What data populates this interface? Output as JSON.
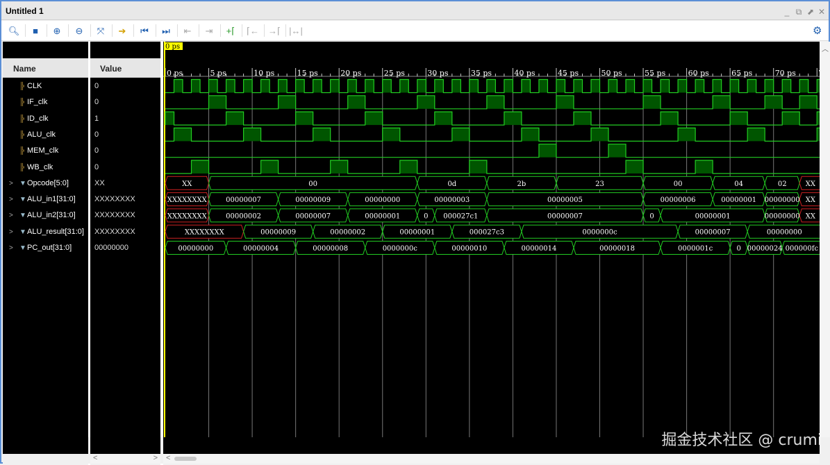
{
  "window": {
    "title": "Untitled 1",
    "controls": [
      "minimize",
      "restore",
      "maximize",
      "close"
    ]
  },
  "toolbar": {
    "buttons": [
      {
        "name": "search-icon",
        "glyph": "🔍︎"
      },
      {
        "name": "save-icon",
        "glyph": "■"
      },
      {
        "name": "zoom-in-icon",
        "glyph": "⊕"
      },
      {
        "name": "zoom-out-icon",
        "glyph": "⊖"
      },
      {
        "name": "zoom-fit-icon",
        "glyph": "⤧"
      },
      {
        "name": "go-to-cursor-icon",
        "glyph": "➔"
      },
      {
        "name": "go-to-time-zero-icon",
        "glyph": "⏮"
      },
      {
        "name": "go-to-last-time-icon",
        "glyph": "⏭"
      },
      {
        "name": "previous-transition-icon",
        "glyph": "⇤"
      },
      {
        "name": "next-transition-icon",
        "glyph": "⇥"
      },
      {
        "name": "add-marker-icon",
        "glyph": "+⌈"
      },
      {
        "name": "previous-marker-icon",
        "glyph": "⌈←"
      },
      {
        "name": "next-marker-icon",
        "glyph": "→⌈"
      },
      {
        "name": "swap-cursors-icon",
        "glyph": "|↔|"
      }
    ],
    "settings_icon": "gear-icon"
  },
  "headers": {
    "name": "Name",
    "value": "Value"
  },
  "cursor": {
    "label": "0 ps",
    "color": "#ffff00"
  },
  "timeline": {
    "unit": "ps",
    "labels": [
      "0 ps",
      "5 ps",
      "10 ps",
      "15 ps",
      "20 ps",
      "25 ps",
      "30 ps",
      "35 ps",
      "40 ps",
      "45 ps",
      "50 ps",
      "55 ps",
      "60 ps",
      "65 ps",
      "70 ps",
      "7"
    ],
    "range_ps": [
      0,
      75.5
    ]
  },
  "colors": {
    "wave": "#22cc22",
    "wave_fill": "#005500",
    "x_value": "#cc2222",
    "grid": "#777777"
  },
  "signals": [
    {
      "name": "CLK",
      "value": "0",
      "type": "bit",
      "highs": [
        [
          1,
          2
        ],
        [
          3,
          4
        ],
        [
          5,
          6
        ],
        [
          7,
          8
        ],
        [
          9,
          10
        ],
        [
          11,
          12
        ],
        [
          13,
          14
        ],
        [
          15,
          16
        ],
        [
          17,
          18
        ],
        [
          19,
          20
        ],
        [
          21,
          22
        ],
        [
          23,
          24
        ],
        [
          25,
          26
        ],
        [
          27,
          28
        ],
        [
          29,
          30
        ],
        [
          31,
          32
        ],
        [
          33,
          34
        ],
        [
          35,
          36
        ],
        [
          37,
          38
        ],
        [
          39,
          40
        ],
        [
          41,
          42
        ],
        [
          43,
          44
        ],
        [
          45,
          46
        ],
        [
          47,
          48
        ],
        [
          49,
          50
        ],
        [
          51,
          52
        ],
        [
          53,
          54
        ],
        [
          55,
          56
        ],
        [
          57,
          58
        ],
        [
          59,
          60
        ],
        [
          61,
          62
        ],
        [
          63,
          64
        ],
        [
          65,
          66
        ],
        [
          67,
          68
        ],
        [
          69,
          70
        ],
        [
          71,
          72
        ],
        [
          73,
          74
        ],
        [
          75,
          76
        ]
      ]
    },
    {
      "name": "IF_clk",
      "value": "0",
      "type": "bit",
      "highs": [
        [
          5,
          7
        ],
        [
          13,
          15
        ],
        [
          21,
          23
        ],
        [
          29,
          31
        ],
        [
          37,
          39
        ],
        [
          45,
          47
        ],
        [
          55,
          57
        ],
        [
          63,
          65
        ],
        [
          69,
          71
        ],
        [
          73,
          75
        ]
      ]
    },
    {
      "name": "ID_clk",
      "value": "1",
      "type": "bit",
      "highs": [
        [
          0,
          1
        ],
        [
          7,
          9
        ],
        [
          15,
          17
        ],
        [
          23,
          25
        ],
        [
          31,
          33
        ],
        [
          39,
          41
        ],
        [
          47,
          49
        ],
        [
          57,
          59
        ],
        [
          65,
          67
        ],
        [
          71,
          73
        ],
        [
          75,
          76
        ]
      ]
    },
    {
      "name": "ALU_clk",
      "value": "0",
      "type": "bit",
      "highs": [
        [
          1,
          3
        ],
        [
          9,
          11
        ],
        [
          17,
          19
        ],
        [
          25,
          27
        ],
        [
          33,
          35
        ],
        [
          41,
          43
        ],
        [
          49,
          51
        ],
        [
          59,
          61
        ],
        [
          67,
          69
        ],
        [
          75,
          76
        ]
      ]
    },
    {
      "name": "MEM_clk",
      "value": "0",
      "type": "bit",
      "highs": [
        [
          43,
          45
        ],
        [
          51,
          53
        ]
      ]
    },
    {
      "name": "WB_clk",
      "value": "0",
      "type": "bit",
      "highs": [
        [
          3,
          5
        ],
        [
          11,
          13
        ],
        [
          19,
          21
        ],
        [
          27,
          29
        ],
        [
          35,
          37
        ],
        [
          53,
          55
        ],
        [
          61,
          63
        ]
      ]
    },
    {
      "name": "Opcode[5:0]",
      "value": "XX",
      "type": "bus",
      "segments": [
        [
          0,
          5,
          "XX"
        ],
        [
          5,
          29,
          "00"
        ],
        [
          29,
          37,
          "0d"
        ],
        [
          37,
          45,
          "2b"
        ],
        [
          45,
          55,
          "23"
        ],
        [
          55,
          63,
          "00"
        ],
        [
          63,
          69,
          "04"
        ],
        [
          69,
          73,
          "02"
        ],
        [
          73,
          76,
          "XX"
        ]
      ]
    },
    {
      "name": "ALU_in1[31:0]",
      "value": "XXXXXXXX",
      "type": "bus",
      "segments": [
        [
          0,
          5,
          "XXXXXXXX"
        ],
        [
          5,
          13,
          "00000007"
        ],
        [
          13,
          21,
          "00000009"
        ],
        [
          21,
          29,
          "00000000"
        ],
        [
          29,
          37,
          "00000003"
        ],
        [
          37,
          55,
          "00000005"
        ],
        [
          55,
          63,
          "00000006"
        ],
        [
          63,
          69,
          "00000001"
        ],
        [
          69,
          73,
          "00000000"
        ],
        [
          73,
          76,
          "XX"
        ]
      ]
    },
    {
      "name": "ALU_in2[31:0]",
      "value": "XXXXXXXX",
      "type": "bus",
      "segments": [
        [
          0,
          5,
          "XXXXXXXX"
        ],
        [
          5,
          13,
          "00000002"
        ],
        [
          13,
          21,
          "00000007"
        ],
        [
          21,
          29,
          "00000001"
        ],
        [
          29,
          31,
          "0"
        ],
        [
          31,
          37,
          "000027c1"
        ],
        [
          37,
          55,
          "00000007"
        ],
        [
          55,
          57,
          "0"
        ],
        [
          57,
          69,
          "00000001"
        ],
        [
          69,
          73,
          "00000000"
        ],
        [
          73,
          76,
          "XX"
        ]
      ]
    },
    {
      "name": "ALU_result[31:0]",
      "value": "XXXXXXXX",
      "type": "bus",
      "segments": [
        [
          0,
          9,
          "XXXXXXXX"
        ],
        [
          9,
          17,
          "00000009"
        ],
        [
          17,
          25,
          "00000002"
        ],
        [
          25,
          33,
          "00000001"
        ],
        [
          33,
          41,
          "000027c3"
        ],
        [
          41,
          59,
          "0000000c"
        ],
        [
          59,
          67,
          "00000007"
        ],
        [
          67,
          76,
          "00000000"
        ]
      ]
    },
    {
      "name": "PC_out[31:0]",
      "value": "00000000",
      "type": "bus",
      "segments": [
        [
          0,
          7,
          "00000000"
        ],
        [
          7,
          15,
          "00000004"
        ],
        [
          15,
          23,
          "00000008"
        ],
        [
          23,
          31,
          "0000000c"
        ],
        [
          31,
          39,
          "00000010"
        ],
        [
          39,
          47,
          "00000014"
        ],
        [
          47,
          57,
          "00000018"
        ],
        [
          57,
          65,
          "0000001c"
        ],
        [
          65,
          67,
          "0"
        ],
        [
          67,
          71,
          "00000024"
        ],
        [
          71,
          76,
          "000000fc"
        ]
      ]
    }
  ],
  "watermark": "掘金技术社区 @ crumi"
}
